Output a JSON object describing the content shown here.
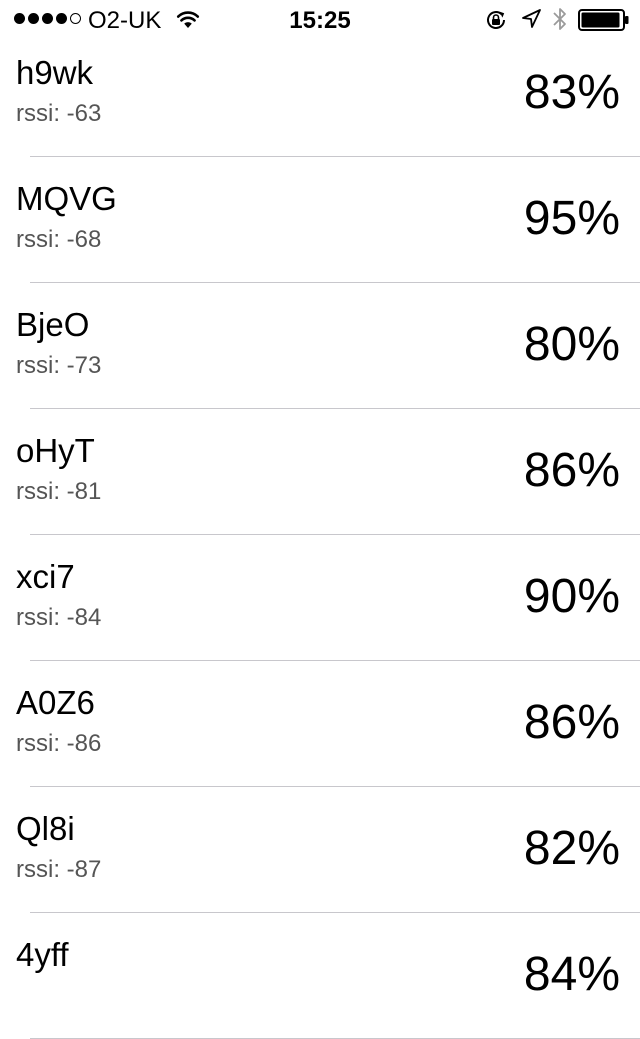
{
  "status_bar": {
    "signal_bars_filled": 4,
    "signal_bars_total": 5,
    "carrier": "O2-UK",
    "time": "15:25",
    "battery_level": 0.95,
    "icons": [
      "wifi-icon",
      "rotation-lock-icon",
      "location-arrow-icon",
      "bluetooth-icon",
      "battery-icon"
    ]
  },
  "devices": [
    {
      "name": "h9wk",
      "rssi": "rssi: -63",
      "percent": "83%"
    },
    {
      "name": "MQVG",
      "rssi": "rssi: -68",
      "percent": "95%"
    },
    {
      "name": "BjeO",
      "rssi": "rssi: -73",
      "percent": "80%"
    },
    {
      "name": "oHyT",
      "rssi": "rssi: -81",
      "percent": "86%"
    },
    {
      "name": "xci7",
      "rssi": "rssi: -84",
      "percent": "90%"
    },
    {
      "name": "A0Z6",
      "rssi": "rssi: -86",
      "percent": "86%"
    },
    {
      "name": "Ql8i",
      "rssi": "rssi: -87",
      "percent": "82%"
    },
    {
      "name": "4yff",
      "rssi": "",
      "percent": "84%"
    }
  ],
  "colors": {
    "background": "#ffffff",
    "text": "#000000",
    "secondary_text": "#555555",
    "separator": "#c8c7cc"
  }
}
